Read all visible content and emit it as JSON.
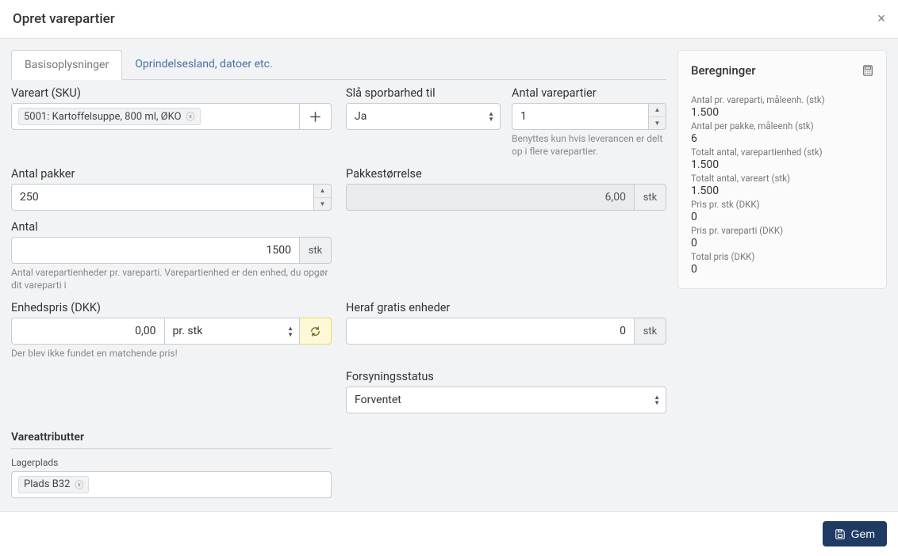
{
  "header": {
    "title": "Opret varepartier"
  },
  "tabs": {
    "basic": "Basisoplysninger",
    "origin": "Oprindelsesland, datoer etc."
  },
  "form": {
    "sku": {
      "label": "Vareart (SKU)",
      "chip": "5001: Kartoffelsuppe, 800 ml, ØKO"
    },
    "traceability": {
      "label": "Slå sporbarhed til",
      "value": "Ja"
    },
    "lot_count": {
      "label": "Antal varepartier",
      "value": "1",
      "help": "Benyttes kun hvis leverancen er delt op i flere varepartier."
    },
    "packages": {
      "label": "Antal pakker",
      "value": "250"
    },
    "pack_size": {
      "label": "Pakkestørrelse",
      "value": "6,00",
      "unit": "stk"
    },
    "qty": {
      "label": "Antal",
      "value": "1500",
      "unit": "stk",
      "help": "Antal varepartienheder pr. vareparti. Varepartienhed er den enhed, du opgør dit vareparti i"
    },
    "unit_price": {
      "label": "Enhedspris (DKK)",
      "value": "0,00",
      "per_unit": "pr. stk",
      "help": "Der blev ikke fundet en matchende pris!"
    },
    "free_units": {
      "label": "Heraf gratis enheder",
      "value": "0",
      "unit": "stk"
    },
    "supply_status": {
      "label": "Forsyningsstatus",
      "value": "Forventet"
    },
    "attributes": {
      "heading": "Vareattributter",
      "storage_label": "Lagerplads",
      "storage_chip": "Plads B32"
    }
  },
  "calc": {
    "heading": "Beregninger",
    "rows": [
      {
        "label": "Antal pr. vareparti, måleenh. (stk)",
        "value": "1.500"
      },
      {
        "label": "Antal per pakke, måleenh (stk)",
        "value": "6"
      },
      {
        "label": "Totalt antal, varepartienhed (stk)",
        "value": "1.500"
      },
      {
        "label": "Totalt antal, vareart (stk)",
        "value": "1.500"
      },
      {
        "label": "Pris pr. stk (DKK)",
        "value": "0"
      },
      {
        "label": "Pris pr. vareparti (DKK)",
        "value": "0"
      },
      {
        "label": "Total pris (DKK)",
        "value": "0"
      }
    ]
  },
  "footer": {
    "save": "Gem"
  }
}
